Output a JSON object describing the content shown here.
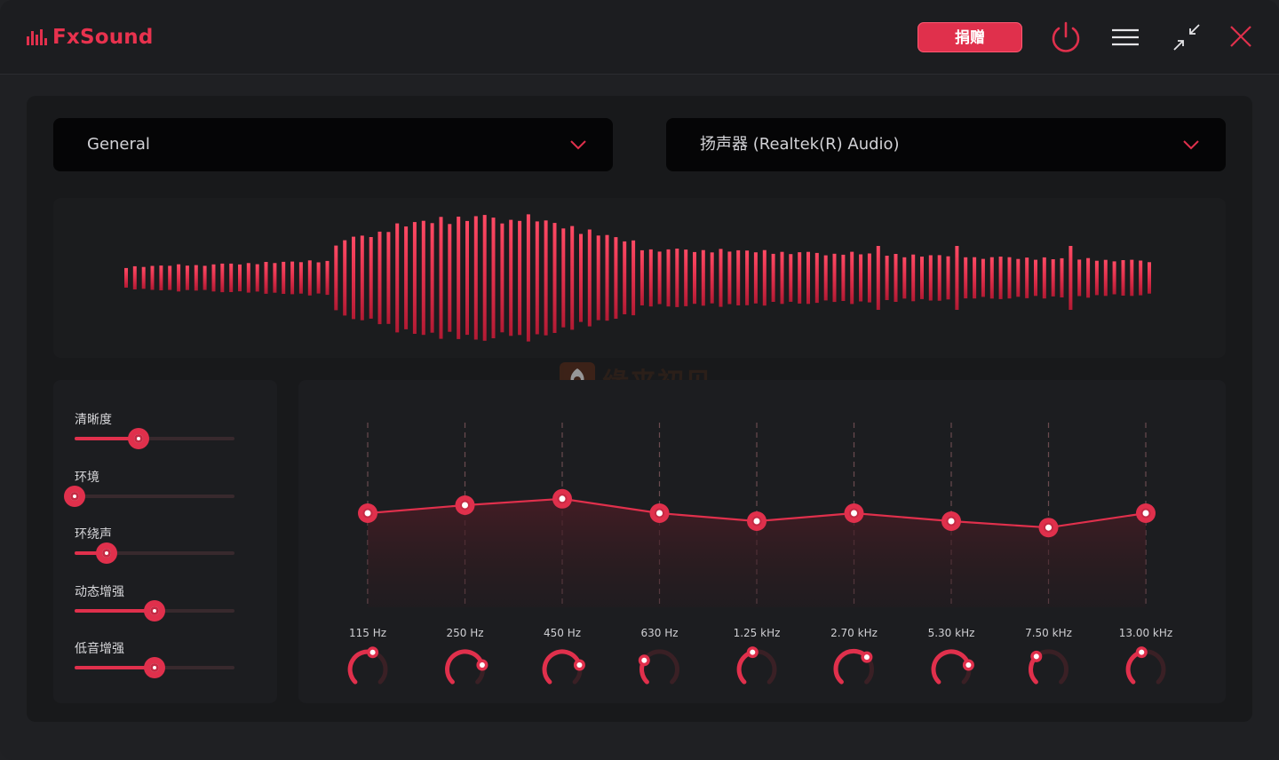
{
  "app": {
    "name": "FxSound",
    "donate_label": "捐赠"
  },
  "titlebar": {
    "icons": [
      "power-icon",
      "menu-icon",
      "minimize-icon",
      "close-icon"
    ]
  },
  "dropdowns": {
    "preset": {
      "value": "General"
    },
    "device": {
      "value": "扬声器 (Realtek(R) Audio)"
    }
  },
  "watermark": {
    "text": "缘来初见"
  },
  "effects": [
    {
      "label": "清晰度",
      "value": 0.4
    },
    {
      "label": "环境",
      "value": 0.0
    },
    {
      "label": "环绕声",
      "value": 0.2
    },
    {
      "label": "动态增强",
      "value": 0.5
    },
    {
      "label": "低音增强",
      "value": 0.5
    }
  ],
  "equalizer": {
    "bands": [
      {
        "label": "115 Hz",
        "level": 0.5,
        "knob": 0.56
      },
      {
        "label": "250 Hz",
        "level": 0.55,
        "knob": 0.78
      },
      {
        "label": "450 Hz",
        "level": 0.59,
        "knob": 0.78
      },
      {
        "label": "630 Hz",
        "level": 0.5,
        "knob": 0.28
      },
      {
        "label": "1.25 kHz",
        "level": 0.45,
        "knob": 0.45
      },
      {
        "label": "2.70 kHz",
        "level": 0.5,
        "knob": 0.67
      },
      {
        "label": "5.30 kHz",
        "level": 0.45,
        "knob": 0.78
      },
      {
        "label": "7.50 kHz",
        "level": 0.41,
        "knob": 0.34
      },
      {
        "label": "13.00 kHz",
        "level": 0.5,
        "knob": 0.45
      }
    ]
  },
  "colors": {
    "accent": "#e0304c",
    "accent_bright": "#ff3b57",
    "panel": "#18191b",
    "dropdown": "#050506"
  }
}
